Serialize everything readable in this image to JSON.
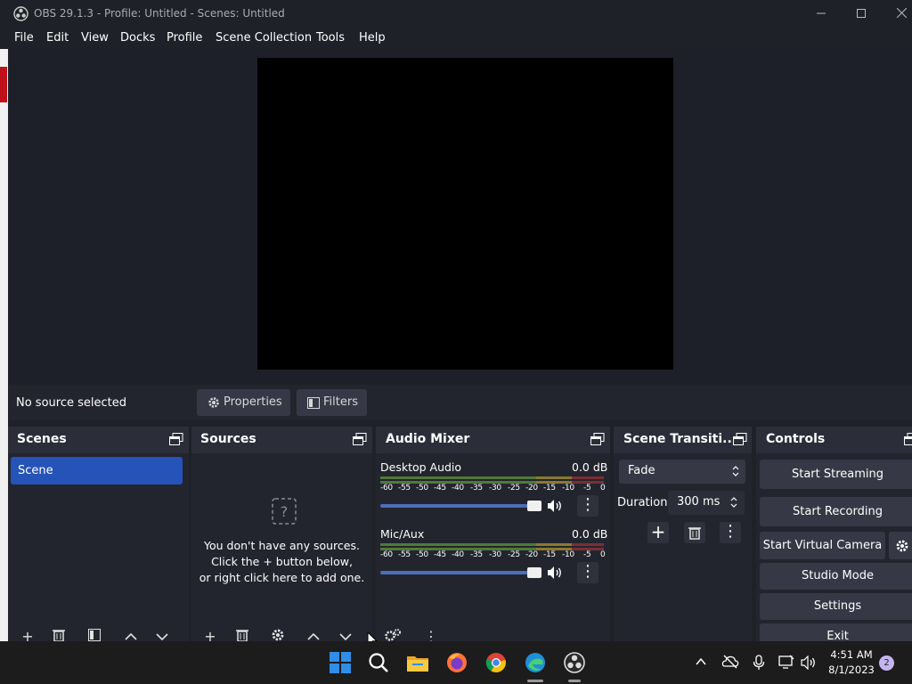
{
  "window": {
    "title": "OBS 29.1.3 - Profile: Untitled - Scenes: Untitled",
    "minimize_icon": "minimize-icon",
    "maximize_icon": "maximize-icon",
    "close_icon": "close-icon"
  },
  "menu": [
    "File",
    "Edit",
    "View",
    "Docks",
    "Profile",
    "Scene Collection",
    "Tools",
    "Help"
  ],
  "source_toolbar": {
    "status": "No source selected",
    "properties_label": "Properties",
    "filters_label": "Filters"
  },
  "docks": {
    "scenes": {
      "title": "Scenes",
      "items": [
        "Scene"
      ]
    },
    "sources": {
      "title": "Sources",
      "empty_line1": "You don't have any sources.",
      "empty_line2": "Click the + button below,",
      "empty_line3": "or right click here to add one."
    },
    "audio_mixer": {
      "title": "Audio Mixer",
      "scale": [
        "-60",
        "-55",
        "-50",
        "-45",
        "-40",
        "-35",
        "-30",
        "-25",
        "-20",
        "-15",
        "-10",
        "-5",
        "0"
      ],
      "channels": [
        {
          "name": "Desktop Audio",
          "level": "0.0 dB",
          "volume": 1.0
        },
        {
          "name": "Mic/Aux",
          "level": "0.0 dB",
          "volume": 1.0
        }
      ]
    },
    "transitions": {
      "title": "Scene Transiti...",
      "transition": "Fade",
      "duration_label": "Duration",
      "duration_value": "300 ms"
    },
    "controls": {
      "title": "Controls",
      "start_streaming": "Start Streaming",
      "start_recording": "Start Recording",
      "start_virtual_camera": "Start Virtual Camera",
      "studio_mode": "Studio Mode",
      "settings": "Settings",
      "exit": "Exit"
    }
  },
  "taskbar": {
    "time": "4:51 AM",
    "date": "8/1/2023",
    "notification_count": "2",
    "apps": [
      "windows-start-icon",
      "search-icon",
      "file-explorer-icon",
      "firefox-icon",
      "chrome-icon",
      "edge-icon",
      "obs-icon"
    ]
  },
  "colors": {
    "accent": "#2553b8",
    "panel": "#23252e",
    "button": "#363945",
    "background": "#1f2129"
  }
}
